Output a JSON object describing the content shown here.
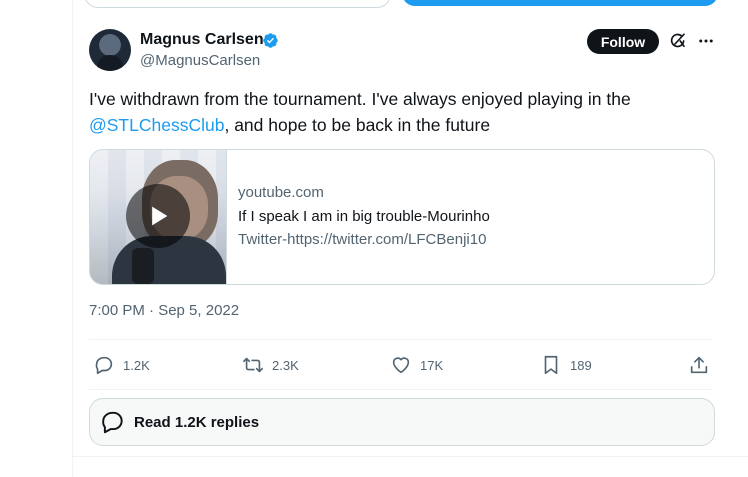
{
  "author": {
    "name": "Magnus Carlsen",
    "handle": "@MagnusCarlsen",
    "verified_color": "#1d9bf0"
  },
  "header": {
    "follow_label": "Follow",
    "grok_icon": "grok-icon",
    "more_icon": "more-icon"
  },
  "tweet": {
    "text_before": "I've withdrawn from the tournament. I've always enjoyed playing in the ",
    "mention": "@STLChessClub",
    "text_after": ", and hope to be back in the future",
    "timestamp": "7:00 PM · Sep 5, 2022"
  },
  "card": {
    "domain": "youtube.com",
    "title": "If I speak I am in big trouble-Mourinho",
    "description": "Twitter-https://twitter.com/LFCBenji10",
    "thumbnail_icon": "play-icon"
  },
  "actions": {
    "replies": "1.2K",
    "reposts": "2.3K",
    "likes": "17K",
    "bookmarks": "189"
  },
  "read_replies_label": "Read 1.2K replies",
  "colors": {
    "accent": "#1d9bf0",
    "text": "#0f1419",
    "muted": "#536471",
    "border": "#cfd9de"
  }
}
